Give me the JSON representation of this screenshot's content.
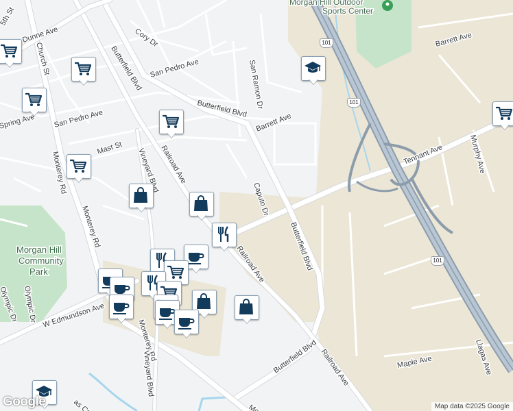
{
  "map": {
    "labels": {
      "morgan_hill_outdoor": "Morgan Hill Outdoor",
      "sports_center": "Sports Center",
      "barrett_ave_ne": "Barrett Ave",
      "dunne_ave": "Dunne Ave",
      "fifth_st": "5th St",
      "cory_dr": "Cory Dr",
      "church_st": "Church St",
      "butterfield_blvd_nw": "Butterfield Blvd",
      "san_pedro_ave_n": "San Pedro Ave",
      "san_ramon_dr": "San Ramon Dr",
      "butterfield_blvd_mid": "Butterfield Blvd",
      "barrett_ave_mid": "Barrett Ave",
      "san_pedro_ave_w": "San Pedro Ave",
      "spring_ave": "Spring Ave",
      "mast_st": "Mast St",
      "tennant_ave": "Tennant Ave",
      "murphy_ave": "Murphy Ave",
      "vineyard_blvd_n": "Vineyard Blvd",
      "railroad_ave_n": "Railroad Ave",
      "caputo_dr": "Caputo Dr",
      "monterey_rd_n": "Monterey Rd",
      "monterey_rd_mid": "Monterey Rd",
      "butterfield_blvd_e": "Butterfield Blvd",
      "railroad_ave_mid": "Railroad Ave",
      "morgan_hill": "Morgan Hill",
      "community": "Community",
      "park": "Park",
      "olympic_dr": "Olympic Dr",
      "w_edmundson_ave": "W Edmundson Ave",
      "monterey_rd_s": "Monterey Rd",
      "vineyard_blvd_s": "Vineyard Blvd",
      "butterfield_blvd_s": "Butterfield Blvd",
      "railroad_ave_s": "Railroad Ave",
      "maple_ave": "Maple Ave",
      "llagas_ave": "Llagas Ave",
      "las_creek": "as Creek",
      "mo_s": "Mo"
    },
    "shields": {
      "hwy_top": "101",
      "hwy_mid": "101",
      "hwy_low": "101"
    },
    "markers": {
      "grocery": "shopping-cart-icon",
      "shop": "shopping-bag-icon",
      "restaurant": "fork-knife-icon",
      "cafe": "coffee-cup-icon",
      "school": "graduation-cap-icon",
      "place": "place-pin-icon"
    },
    "attribution": "Map data ©2025 Google",
    "logo": "Google"
  },
  "colors": {
    "background": "#f2f3f4",
    "urban_tan": "#ece6d6",
    "park_green": "#c6e4c9",
    "highway_outline": "#8c9cab",
    "highway_fill": "#b9c6d3",
    "road": "#ffffff",
    "road_edge": "#d5d8dc",
    "water": "#a6d6ee",
    "marker_icon": "#133b5c"
  }
}
